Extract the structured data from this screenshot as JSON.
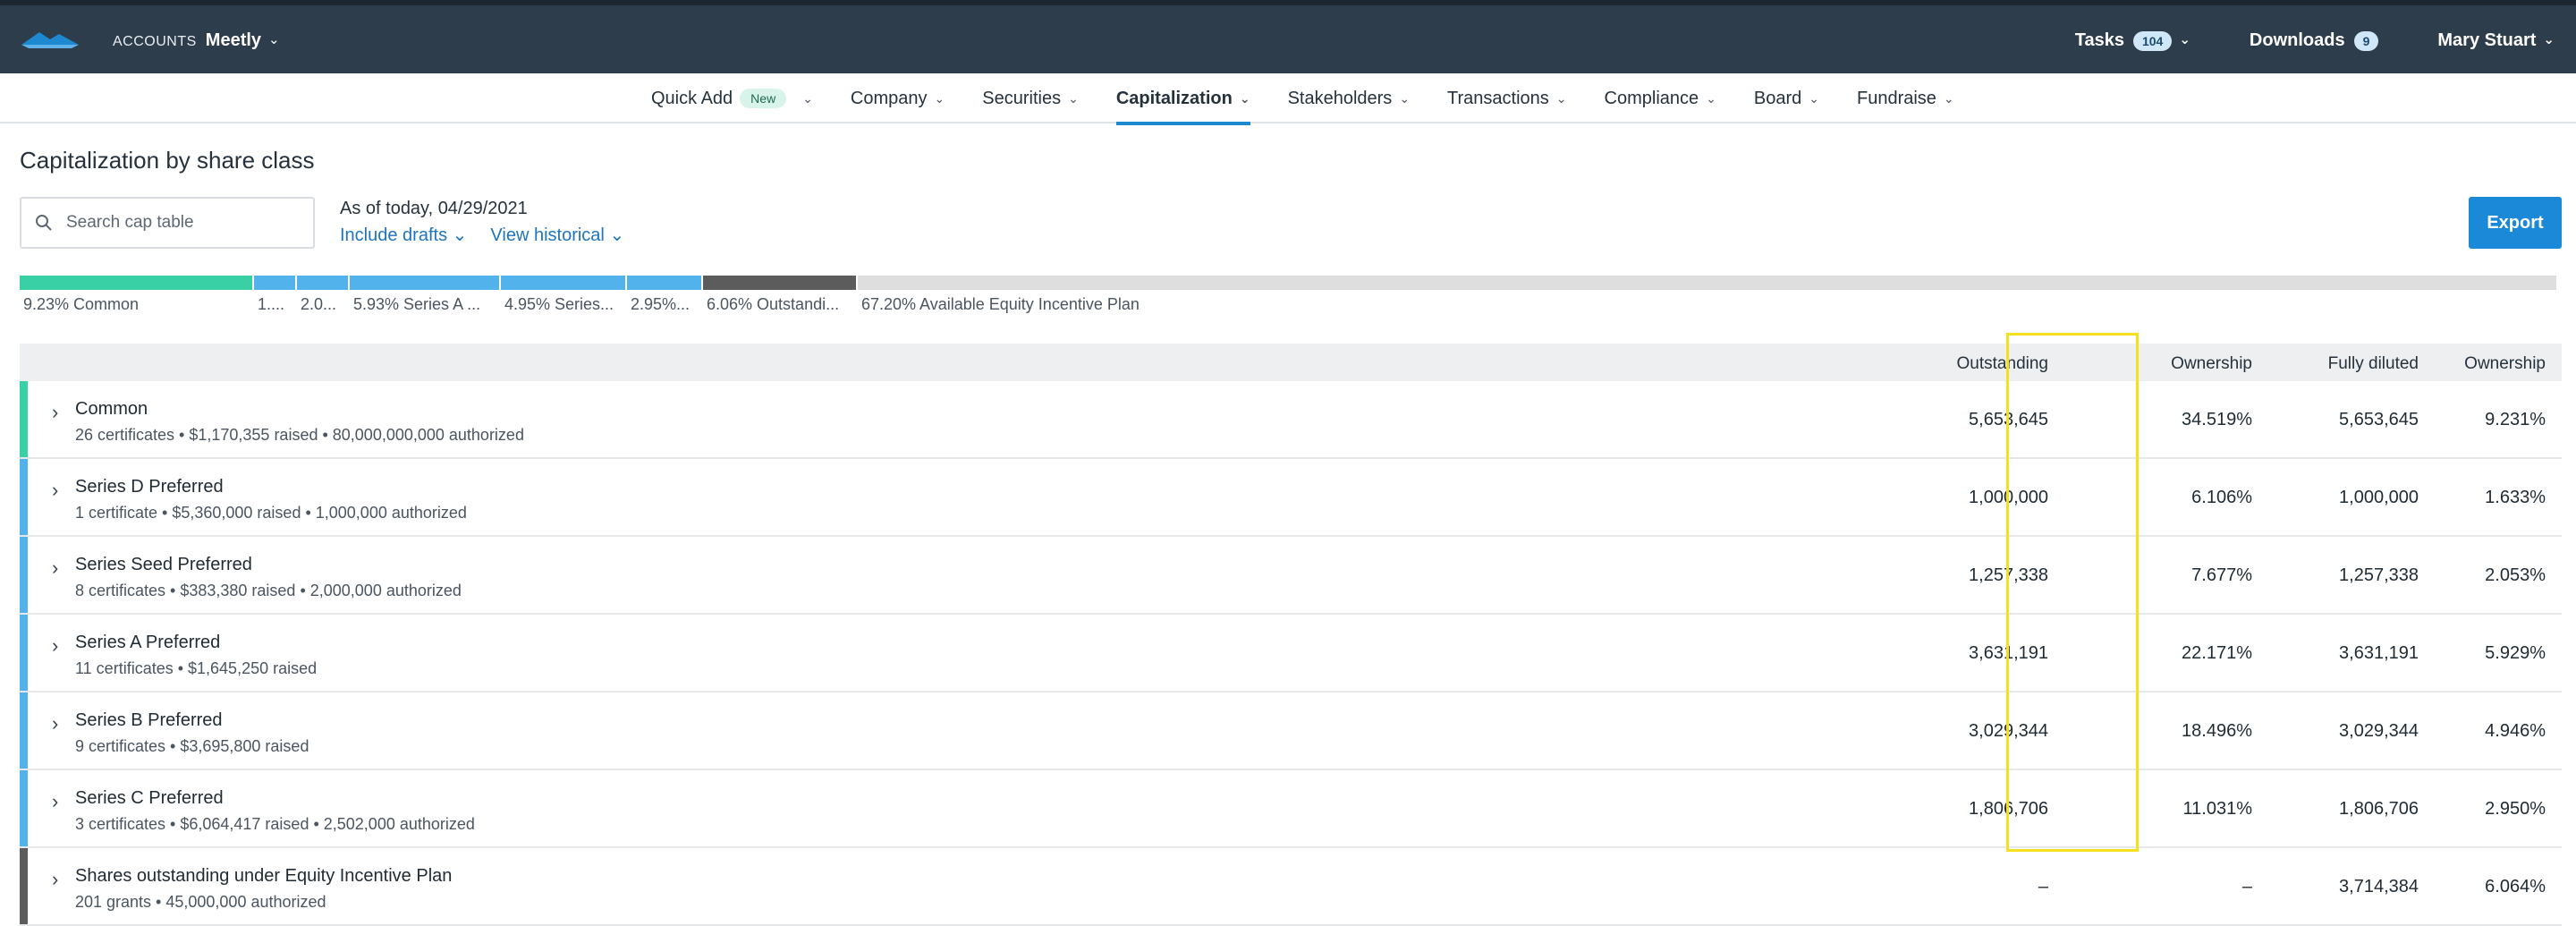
{
  "topbar": {
    "account_label": "ACCOUNTS",
    "account_name": "Meetly",
    "tasks_label": "Tasks",
    "tasks_count": "104",
    "downloads_label": "Downloads",
    "downloads_count": "9",
    "user_name": "Mary Stuart"
  },
  "nav": {
    "quick_add": "Quick Add",
    "new_pill": "New",
    "items": [
      "Company",
      "Securities",
      "Capitalization",
      "Stakeholders",
      "Transactions",
      "Compliance",
      "Board",
      "Fundraise"
    ],
    "active": "Capitalization"
  },
  "page": {
    "title": "Capitalization by share class",
    "search_placeholder": "Search cap table",
    "as_of": "As of today, 04/29/2021",
    "include_drafts": "Include drafts",
    "view_historical": "View historical",
    "export": "Export"
  },
  "distribution": [
    {
      "label": "9.23% Common",
      "share": 9.23,
      "color": "#3ad0a5"
    },
    {
      "label": "1....",
      "share": 1.63,
      "color": "#52b3ec"
    },
    {
      "label": "2.0...",
      "share": 2.05,
      "color": "#52b3ec"
    },
    {
      "label": "5.93% Series A ...",
      "share": 5.93,
      "color": "#52b3ec"
    },
    {
      "label": "4.95% Series...",
      "share": 4.95,
      "color": "#52b3ec"
    },
    {
      "label": "2.95%...",
      "share": 2.95,
      "color": "#52b3ec"
    },
    {
      "label": "6.06% Outstandi...",
      "share": 6.06,
      "color": "#5c5c5c"
    },
    {
      "label": "67.20% Available Equity Incentive Plan",
      "share": 67.2,
      "color": "#dedede"
    }
  ],
  "table": {
    "headers": {
      "outstanding": "Outstanding",
      "ownership": "Ownership",
      "fully_diluted": "Fully diluted",
      "ownership_diluted": "Ownership"
    },
    "rows": [
      {
        "name": "Common",
        "sub": "26 certificates • $1,170,355 raised • 80,000,000,000 authorized",
        "outstanding": "5,653,645",
        "ownership": "34.519%",
        "fully_diluted": "5,653,645",
        "ownership_diluted": "9.231%",
        "color": "#3ad0a5"
      },
      {
        "name": "Series D Preferred",
        "sub": "1 certificate • $5,360,000 raised • 1,000,000 authorized",
        "outstanding": "1,000,000",
        "ownership": "6.106%",
        "fully_diluted": "1,000,000",
        "ownership_diluted": "1.633%",
        "color": "#52b3ec"
      },
      {
        "name": "Series Seed Preferred",
        "sub": "8 certificates • $383,380 raised • 2,000,000 authorized",
        "outstanding": "1,257,338",
        "ownership": "7.677%",
        "fully_diluted": "1,257,338",
        "ownership_diluted": "2.053%",
        "color": "#52b3ec"
      },
      {
        "name": "Series A Preferred",
        "sub": "11 certificates • $1,645,250 raised",
        "outstanding": "3,631,191",
        "ownership": "22.171%",
        "fully_diluted": "3,631,191",
        "ownership_diluted": "5.929%",
        "color": "#52b3ec"
      },
      {
        "name": "Series B Preferred",
        "sub": "9 certificates • $3,695,800 raised",
        "outstanding": "3,029,344",
        "ownership": "18.496%",
        "fully_diluted": "3,029,344",
        "ownership_diluted": "4.946%",
        "color": "#52b3ec"
      },
      {
        "name": "Series C Preferred",
        "sub": "3 certificates • $6,064,417 raised • 2,502,000 authorized",
        "outstanding": "1,806,706",
        "ownership": "11.031%",
        "fully_diluted": "1,806,706",
        "ownership_diluted": "2.950%",
        "color": "#52b3ec"
      },
      {
        "name": "Shares outstanding under Equity Incentive Plan",
        "sub": "201 grants  • 45,000,000 authorized",
        "outstanding": "–",
        "ownership": "–",
        "fully_diluted": "3,714,384",
        "ownership_diluted": "6.064%",
        "color": "#5c5c5c"
      }
    ]
  },
  "colors": {
    "accent": "#1b88d8",
    "topbar": "#2e3d4b",
    "highlight": "#f4e01c"
  }
}
